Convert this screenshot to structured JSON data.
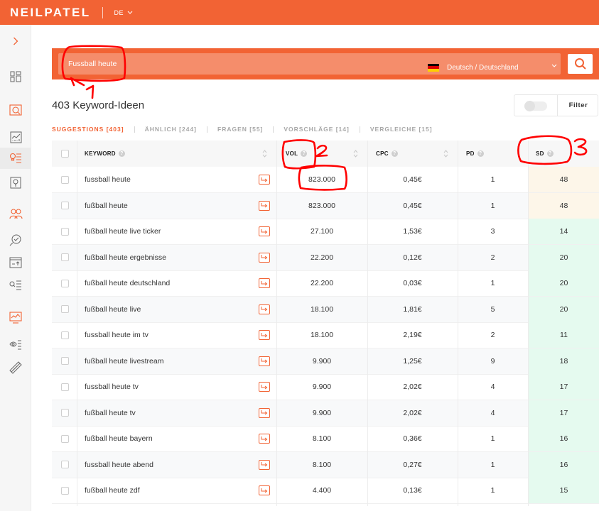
{
  "header": {
    "logo": "NEILPATEL",
    "language": "DE"
  },
  "sidebar": {
    "icons": [
      "expand-icon",
      "dashboard-icon",
      "site-audit-icon",
      "traffic-overview-icon",
      "keyword-ideas-icon",
      "content-ideas-icon",
      "backlinks-icon",
      "seo-analyzer-icon",
      "rank-tracker-icon",
      "keyword-lists-icon",
      "traffic-analyzer-icon",
      "settings-icon",
      "chrome-extension-icon"
    ]
  },
  "search": {
    "query": "Fussball heute",
    "country": "Deutsch / Deutschland",
    "flag_colors": [
      "#000000",
      "#dd0000",
      "#ffce00"
    ]
  },
  "results": {
    "title": "403 Keyword-Ideen",
    "filter_label": "Filter"
  },
  "tabs": [
    {
      "label": "SUGGESTIONS [403]",
      "active": true
    },
    {
      "label": "ÄHNLICH [244]",
      "active": false
    },
    {
      "label": "FRAGEN [55]",
      "active": false
    },
    {
      "label": "VORSCHLÄGE [14]",
      "active": false
    },
    {
      "label": "VERGLEICHE [15]",
      "active": false
    }
  ],
  "table": {
    "headers": {
      "keyword": "KEYWORD",
      "vol": "VOL",
      "cpc": "CPC",
      "pd": "PD",
      "sd": "SD"
    },
    "rows": [
      {
        "keyword": "fussball heute",
        "vol": "823.000",
        "cpc": "0,45€",
        "pd": "1",
        "sd": "48"
      },
      {
        "keyword": "fußball heute",
        "vol": "823.000",
        "cpc": "0,45€",
        "pd": "1",
        "sd": "48"
      },
      {
        "keyword": "fußball heute live ticker",
        "vol": "27.100",
        "cpc": "1,53€",
        "pd": "3",
        "sd": "14"
      },
      {
        "keyword": "fußball heute ergebnisse",
        "vol": "22.200",
        "cpc": "0,12€",
        "pd": "2",
        "sd": "20"
      },
      {
        "keyword": "fußball heute deutschland",
        "vol": "22.200",
        "cpc": "0,03€",
        "pd": "1",
        "sd": "20"
      },
      {
        "keyword": "fußball heute live",
        "vol": "18.100",
        "cpc": "1,81€",
        "pd": "5",
        "sd": "20"
      },
      {
        "keyword": "fussball heute im tv",
        "vol": "18.100",
        "cpc": "2,19€",
        "pd": "2",
        "sd": "11"
      },
      {
        "keyword": "fußball heute livestream",
        "vol": "9.900",
        "cpc": "1,25€",
        "pd": "9",
        "sd": "18"
      },
      {
        "keyword": "fussball heute tv",
        "vol": "9.900",
        "cpc": "2,02€",
        "pd": "4",
        "sd": "17"
      },
      {
        "keyword": "fußball heute tv",
        "vol": "9.900",
        "cpc": "2,02€",
        "pd": "4",
        "sd": "17"
      },
      {
        "keyword": "fußball heute bayern",
        "vol": "8.100",
        "cpc": "0,36€",
        "pd": "1",
        "sd": "16"
      },
      {
        "keyword": "fussball heute abend",
        "vol": "8.100",
        "cpc": "0,27€",
        "pd": "1",
        "sd": "16"
      },
      {
        "keyword": "fußball heute zdf",
        "vol": "4.400",
        "cpc": "0,13€",
        "pd": "1",
        "sd": "15"
      }
    ]
  },
  "colors": {
    "brand": "#f26334",
    "sd_medium": "#fdf6e9",
    "sd_easy": "#e5faef",
    "annotation": "#ff0000"
  },
  "annotations": {
    "markers": [
      "1",
      "2",
      "3"
    ]
  }
}
